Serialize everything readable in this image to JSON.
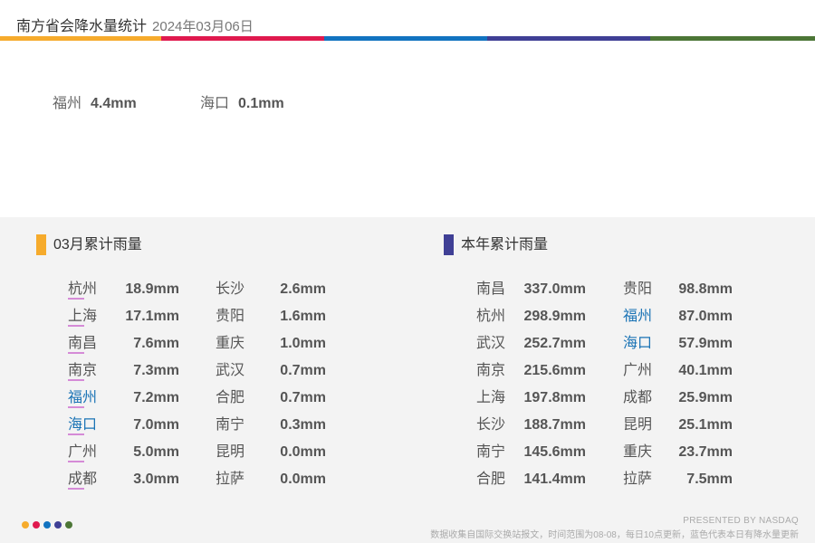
{
  "header": {
    "title": "南方省会降水量统计",
    "date": "2024年03月06日"
  },
  "colors": {
    "orange": "#f6ab2c",
    "red": "#e0194e",
    "blue": "#1273c0",
    "purple": "#3f3f95",
    "green": "#4c7636",
    "city_blue": "#1a73b5",
    "underline": "#d58bd7"
  },
  "today": [
    {
      "city": "福州",
      "value": "4.4mm"
    },
    {
      "city": "海口",
      "value": "0.1mm"
    }
  ],
  "month": {
    "title": "03月累计雨量",
    "left": [
      {
        "city": "杭州",
        "value": "18.9mm"
      },
      {
        "city": "上海",
        "value": "17.1mm"
      },
      {
        "city": "南昌",
        "value": "7.6mm"
      },
      {
        "city": "南京",
        "value": "7.3mm"
      },
      {
        "city": "福州",
        "value": "7.2mm"
      },
      {
        "city": "海口",
        "value": "7.0mm"
      },
      {
        "city": "广州",
        "value": "5.0mm"
      },
      {
        "city": "成都",
        "value": "3.0mm"
      }
    ],
    "right": [
      {
        "city": "长沙",
        "value": "2.6mm"
      },
      {
        "city": "贵阳",
        "value": "1.6mm"
      },
      {
        "city": "重庆",
        "value": "1.0mm"
      },
      {
        "city": "武汉",
        "value": "0.7mm"
      },
      {
        "city": "合肥",
        "value": "0.7mm"
      },
      {
        "city": "南宁",
        "value": "0.3mm"
      },
      {
        "city": "昆明",
        "value": "0.0mm"
      },
      {
        "city": "拉萨",
        "value": "0.0mm"
      }
    ]
  },
  "year": {
    "title": "本年累计雨量",
    "left": [
      {
        "city": "南昌",
        "value": "337.0mm"
      },
      {
        "city": "杭州",
        "value": "298.9mm"
      },
      {
        "city": "武汉",
        "value": "252.7mm"
      },
      {
        "city": "南京",
        "value": "215.6mm"
      },
      {
        "city": "上海",
        "value": "197.8mm"
      },
      {
        "city": "长沙",
        "value": "188.7mm"
      },
      {
        "city": "南宁",
        "value": "145.6mm"
      },
      {
        "city": "合肥",
        "value": "141.4mm"
      }
    ],
    "right": [
      {
        "city": "贵阳",
        "value": "98.8mm"
      },
      {
        "city": "福州",
        "value": "87.0mm"
      },
      {
        "city": "海口",
        "value": "57.9mm"
      },
      {
        "city": "广州",
        "value": "40.1mm"
      },
      {
        "city": "成都",
        "value": "25.9mm"
      },
      {
        "city": "昆明",
        "value": "25.1mm"
      },
      {
        "city": "重庆",
        "value": "23.7mm"
      },
      {
        "city": "拉萨",
        "value": "7.5mm"
      }
    ]
  },
  "footer": {
    "presented": "PRESENTED BY NASDAQ",
    "note": "数据收集自国际交换站报文，时间范围为08-08，每日10点更新，蓝色代表本日有降水量更新"
  }
}
